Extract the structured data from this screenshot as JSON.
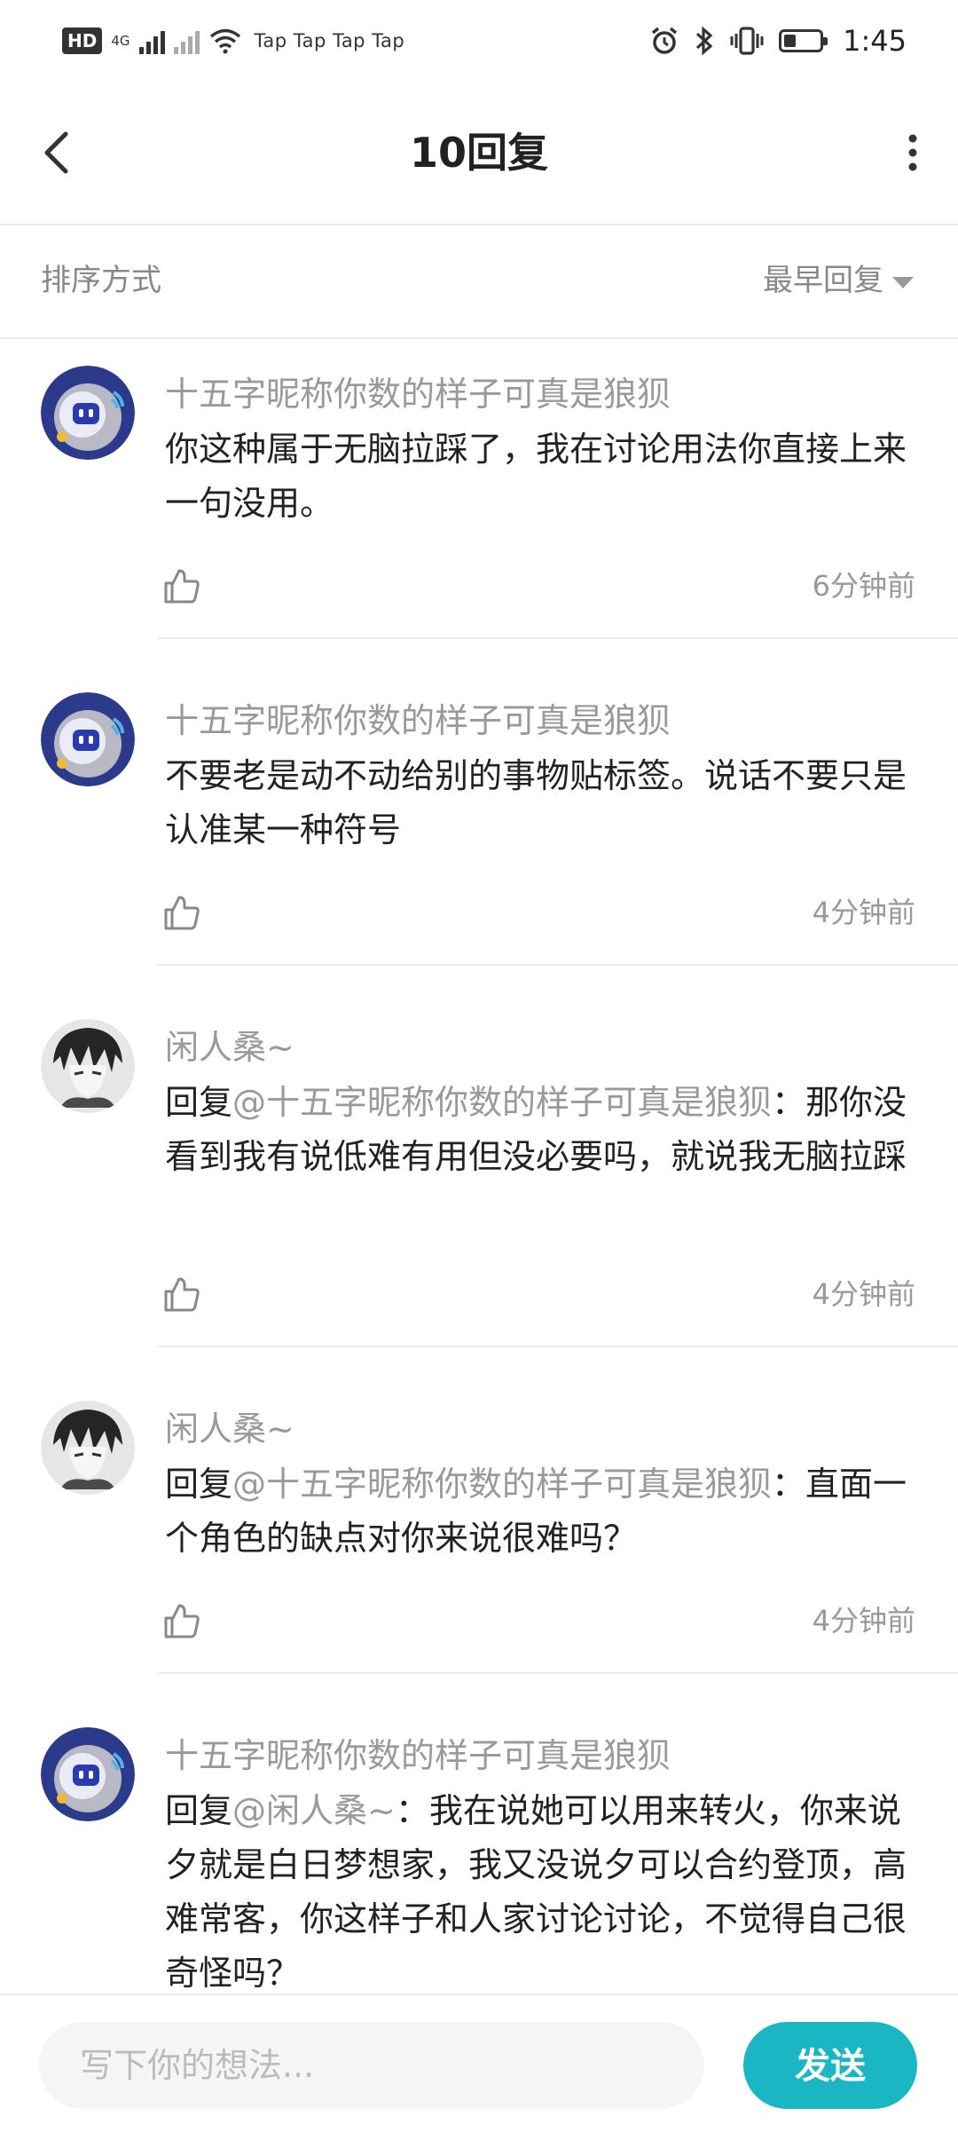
{
  "status_bar": {
    "hd": "HD",
    "net": "4G",
    "tap_text": "Tap Tap Tap Tap",
    "time": "1:45",
    "battery_level": 0.35
  },
  "header": {
    "title": "10回复"
  },
  "sort": {
    "label": "排序方式",
    "value": "最早回复"
  },
  "comments": [
    {
      "user": "十五字昵称你数的样子可真是狼狈",
      "avatar": "robot-avatar",
      "prefix": "",
      "mention": "",
      "text": "你这种属于无脑拉踩了，我在讨论用法你直接上来一句没用。",
      "time": "6分钟前"
    },
    {
      "user": "十五字昵称你数的样子可真是狼狈",
      "avatar": "robot-avatar",
      "prefix": "",
      "mention": "",
      "text": "不要老是动不动给别的事物贴标签。说话不要只是认准某一种符号",
      "time": "4分钟前"
    },
    {
      "user": "闲人桑~",
      "avatar": "anime-avatar",
      "prefix": "回复",
      "mention": "@十五字昵称你数的样子可真是狼狈",
      "text": "：那你没看到我有说低难有用但没必要吗，就说我无脑拉踩",
      "time": "4分钟前"
    },
    {
      "user": "闲人桑~",
      "avatar": "anime-avatar",
      "prefix": "回复",
      "mention": "@十五字昵称你数的样子可真是狼狈",
      "text": "：直面一个角色的缺点对你来说很难吗？",
      "time": "4分钟前"
    },
    {
      "user": "十五字昵称你数的样子可真是狼狈",
      "avatar": "robot-avatar",
      "prefix": "回复",
      "mention": "@闲人桑~",
      "text": "：我在说她可以用来转火，你来说夕就是白日梦想家，我又没说夕可以合约登顶，高难常客，你这样子和人家讨论讨论，不觉得自己很奇怪吗？",
      "time": ""
    }
  ],
  "input": {
    "placeholder": "写下你的想法..."
  },
  "send_label": "发送",
  "colors": {
    "accent": "#1bb6c3",
    "muted_text": "#999999",
    "body_text": "#222222"
  }
}
